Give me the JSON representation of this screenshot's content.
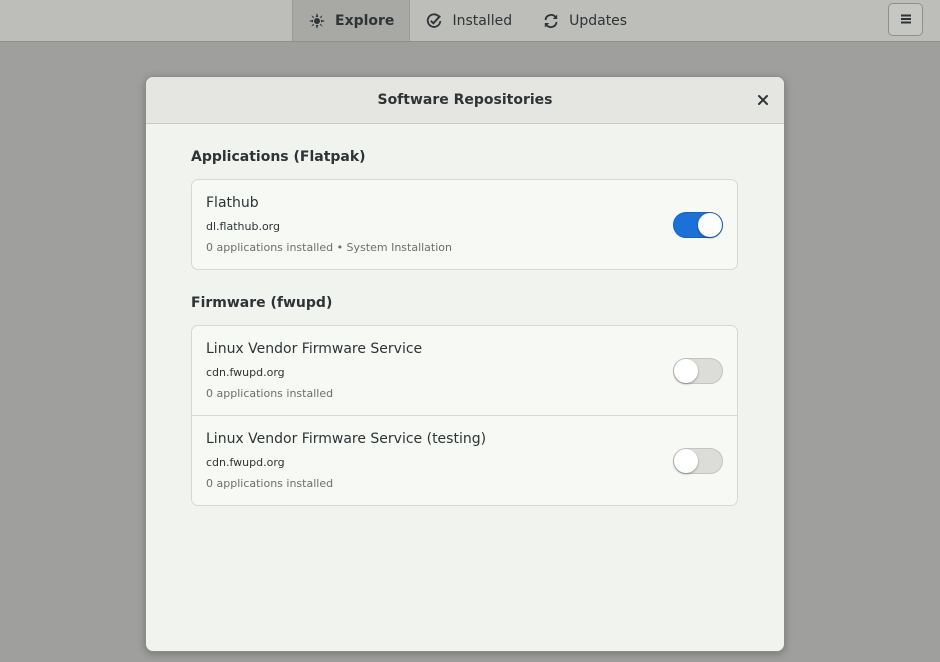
{
  "headerbar": {
    "tabs": [
      {
        "label": "Explore",
        "icon": "compass-icon",
        "active": true
      },
      {
        "label": "Installed",
        "icon": "check-circle-icon",
        "active": false
      },
      {
        "label": "Updates",
        "icon": "refresh-icon",
        "active": false
      }
    ],
    "menu_icon": "hamburger-menu-icon"
  },
  "dialog": {
    "title": "Software Repositories",
    "close_icon": "close-icon",
    "sections": [
      {
        "title": "Applications (Flatpak)",
        "items": [
          {
            "name": "Flathub",
            "url": "dl.flathub.org",
            "info": "0 applications installed • System Installation",
            "enabled": true
          }
        ]
      },
      {
        "title": "Firmware (fwupd)",
        "items": [
          {
            "name": "Linux Vendor Firmware Service",
            "url": "cdn.fwupd.org",
            "info": "0 applications installed",
            "enabled": false
          },
          {
            "name": "Linux Vendor Firmware Service (testing)",
            "url": "cdn.fwupd.org",
            "info": "0 applications installed",
            "enabled": false
          }
        ]
      }
    ]
  },
  "colors": {
    "accent": "#1c71d8",
    "dialog_bg": "#f1f3ef",
    "backdrop": "#9f9f9d"
  }
}
